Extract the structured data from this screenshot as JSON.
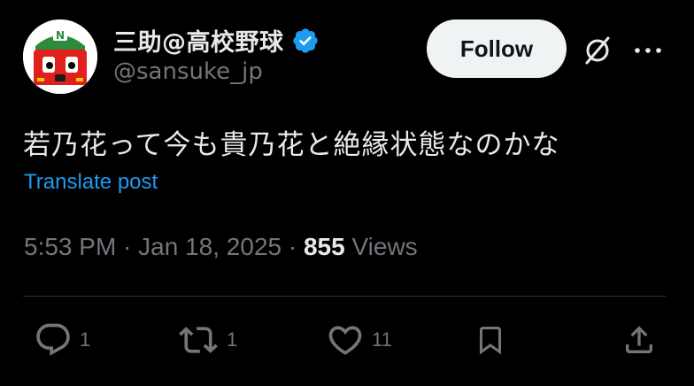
{
  "author": {
    "display_name": "三助@高校野球",
    "handle": "@sansuke_jp",
    "verified": true,
    "avatar_icon": "train-mascot-avatar",
    "avatar_letter": "N"
  },
  "header": {
    "follow_label": "Follow",
    "grok_icon": "grok-icon",
    "more_icon": "more-icon"
  },
  "post": {
    "text": "若乃花って今も貴乃花と絶縁状態なのかな",
    "translate_label": "Translate post",
    "time": "5:53 PM",
    "separator": " · ",
    "date": "Jan 18, 2025",
    "views_count": "855",
    "views_label": "Views"
  },
  "actions": {
    "reply_count": "1",
    "retweet_count": "1",
    "like_count": "11"
  },
  "colors": {
    "background": "#000000",
    "text_primary": "#e7e9ea",
    "text_secondary": "#71767b",
    "link": "#1d9bf0",
    "verified": "#1d9bf0",
    "divider": "#2f3336",
    "follow_bg": "#eff3f4"
  }
}
